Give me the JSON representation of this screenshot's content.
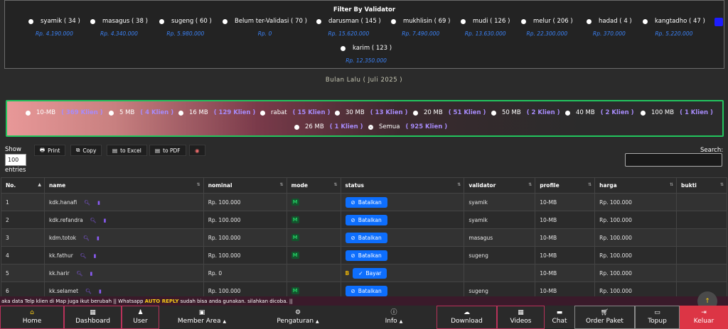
{
  "filter": {
    "title": "Filter By Validator",
    "validators": [
      {
        "name": "syamik ( 34 )",
        "amount": "Rp. 4.190.000"
      },
      {
        "name": "masagus ( 38 )",
        "amount": "Rp. 4.340.000"
      },
      {
        "name": "sugeng ( 60 )",
        "amount": "Rp. 5.980.000"
      },
      {
        "name": "Belum ter-Validasi ( 70 )",
        "amount": "Rp. 0"
      },
      {
        "name": "darusman ( 145 )",
        "amount": "Rp. 15.620.000"
      },
      {
        "name": "mukhlisin ( 69 )",
        "amount": "Rp. 7.490.000"
      },
      {
        "name": "mudi ( 126 )",
        "amount": "Rp. 13.630.000"
      },
      {
        "name": "melur ( 206 )",
        "amount": "Rp. 22.300.000"
      },
      {
        "name": "hadad ( 4 )",
        "amount": "Rp. 370.000"
      },
      {
        "name": "kangtadho ( 47 )",
        "amount": "Rp. 5.220.000"
      },
      {
        "name": "karim ( 123 )",
        "amount": "Rp. 12.350.000"
      }
    ]
  },
  "bulan": "Bulan Lalu ( Juli 2025 )",
  "paket": [
    {
      "name": "10-MB",
      "count": "( 369 Klien )"
    },
    {
      "name": "5 MB",
      "count": "( 4 Klien )"
    },
    {
      "name": "16 MB",
      "count": "( 129 Klien )"
    },
    {
      "name": "rabat",
      "count": "( 15 Klien )"
    },
    {
      "name": "30 MB",
      "count": "( 13 Klien )"
    },
    {
      "name": "20 MB",
      "count": "( 51 Klien )"
    },
    {
      "name": "50 MB",
      "count": "( 2 Klien )"
    },
    {
      "name": "40 MB",
      "count": "( 2 Klien )"
    },
    {
      "name": "100 MB",
      "count": "( 1 Klien )"
    },
    {
      "name": "26 MB",
      "count": "( 1 Klien )"
    },
    {
      "name": "Semua",
      "count": "( 925 Klien )"
    }
  ],
  "toolbar": {
    "show": "Show",
    "entries_value": "100",
    "entries": "entries",
    "print": "Print",
    "copy": "Copy",
    "excel": "to Excel",
    "pdf": "to PDF",
    "search": "Search:"
  },
  "table": {
    "headers": [
      "No.",
      "name",
      "nominal",
      "mode",
      "status",
      "validator",
      "profile",
      "harga",
      "bukti"
    ],
    "rows": [
      {
        "no": "1",
        "name": "kdk.hanafi",
        "nominal": "Rp. 100.000",
        "mode": "M",
        "status": "Batalkan",
        "validator": "syamik",
        "profile": "10-MB",
        "harga": "Rp. 100.000"
      },
      {
        "no": "2",
        "name": "kdk.refandra",
        "nominal": "Rp. 100.000",
        "mode": "M",
        "status": "Batalkan",
        "validator": "syamik",
        "profile": "10-MB",
        "harga": "Rp. 100.000"
      },
      {
        "no": "3",
        "name": "kdm.totok",
        "nominal": "Rp. 100.000",
        "mode": "M",
        "status": "Batalkan",
        "validator": "masagus",
        "profile": "10-MB",
        "harga": "Rp. 100.000"
      },
      {
        "no": "4",
        "name": "kk.fathur",
        "nominal": "Rp. 100.000",
        "mode": "M",
        "status": "Batalkan",
        "validator": "sugeng",
        "profile": "10-MB",
        "harga": "Rp. 100.000"
      },
      {
        "no": "5",
        "name": "kk.harir",
        "nominal": "Rp. 0",
        "mode": "",
        "status": "Bayar",
        "b": "B",
        "validator": "",
        "profile": "10-MB",
        "harga": "Rp. 100.000"
      },
      {
        "no": "6",
        "name": "kk.selamet",
        "nominal": "Rp. 100.000",
        "mode": "M",
        "status": "Batalkan",
        "validator": "sugeng",
        "profile": "10-MB",
        "harga": "Rp. 100.000"
      }
    ]
  },
  "marquee": {
    "pre": "aka data Telp klien di Map juga ikut berubah || Whatsapp ",
    "hl": "AUTO REPLY",
    "post": " sudah bisa anda gunakan. silahkan dicoba. ||"
  },
  "nav": {
    "home": "Home",
    "dashboard": "Dashboard",
    "user": "User",
    "member": "Member Area",
    "pengaturan": "Pengaturan",
    "info": "Info",
    "download": "Download",
    "videos": "Videos",
    "chat": "Chat",
    "order": "Order Paket",
    "topup": "Topup",
    "keluar": "Keluar"
  }
}
